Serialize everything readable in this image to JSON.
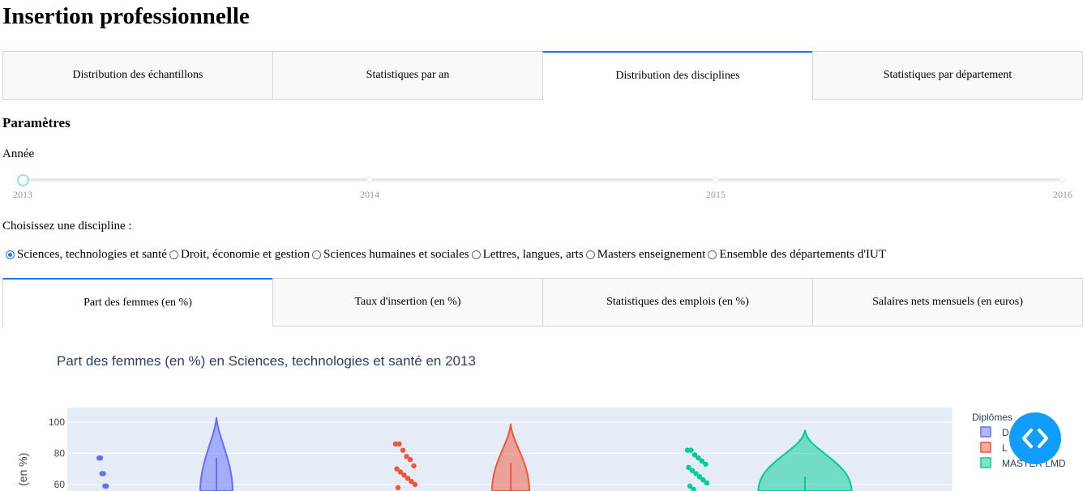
{
  "page_title": "Insertion professionnelle",
  "main_tabs": [
    {
      "label": "Distribution des échantillons"
    },
    {
      "label": "Statistiques par an"
    },
    {
      "label": "Distribution des disciplines"
    },
    {
      "label": "Statistiques par département"
    }
  ],
  "active_main_tab": 2,
  "params_heading": "Paramètres",
  "year_label": "Année",
  "year_slider": {
    "ticks": [
      "2013",
      "2014",
      "2015",
      "2016"
    ],
    "selected": "2013"
  },
  "discipline_label": "Choisissez une discipline :",
  "disciplines": [
    {
      "label": "Sciences, technologies et santé",
      "checked": true
    },
    {
      "label": "Droit, économie et gestion",
      "checked": false
    },
    {
      "label": "Sciences humaines et sociales",
      "checked": false
    },
    {
      "label": "Lettres, langues, arts",
      "checked": false
    },
    {
      "label": "Masters enseignement",
      "checked": false
    },
    {
      "label": "Ensemble des départements d'IUT",
      "checked": false
    }
  ],
  "sub_tabs": [
    {
      "label": "Part des femmes (en %)"
    },
    {
      "label": "Taux d'insertion (en %)"
    },
    {
      "label": "Statistiques des emplois (en %)"
    },
    {
      "label": "Salaires nets mensuels (en euros)"
    }
  ],
  "active_sub_tab": 0,
  "chart_data": {
    "type": "violin",
    "title": "Part des femmes (en %) en Sciences, technologies et santé en 2013",
    "ylabel": "(en %)",
    "y_ticks": [
      60,
      80,
      100
    ],
    "legend_title": "Diplômes",
    "legend_placement": "right",
    "series": [
      {
        "name": "D",
        "color": "#636efa",
        "points": [
          77,
          77,
          67,
          67,
          59,
          59
        ],
        "violin_max": 103,
        "median": 77
      },
      {
        "name": "L",
        "color": "#ef553b",
        "points": [
          86,
          86,
          82,
          78,
          76,
          72,
          70,
          68,
          66,
          64,
          62,
          60,
          58
        ],
        "violin_max": 99,
        "median": 74
      },
      {
        "name": "MASTER LMD",
        "color": "#00cc96",
        "points": [
          82,
          82,
          79,
          77,
          75,
          73,
          71,
          69,
          67,
          65,
          63,
          61,
          59,
          57
        ],
        "violin_max": 95,
        "median": 65
      }
    ]
  },
  "fab_icon": "code-icon"
}
